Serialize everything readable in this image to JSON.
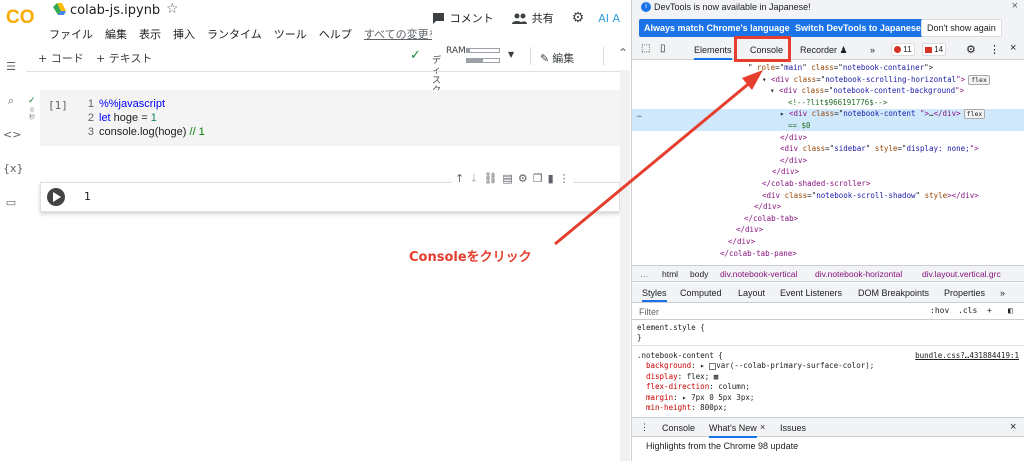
{
  "colab": {
    "logo_text": "CO",
    "file_name": "colab-js.ipynb",
    "menu": [
      "ファイル",
      "編集",
      "表示",
      "挿入",
      "ランタイム",
      "ツール",
      "ヘルプ"
    ],
    "last_edit": "すべての変更を",
    "comment_label": "コメント",
    "share_label": "共有",
    "ai_label": "AI A",
    "add_code": "+ コード",
    "add_text": "+ テキスト",
    "ram_label": "RAM",
    "disk_label": "ディスク",
    "ram_fraction": 0.1,
    "disk_fraction": 0.5,
    "edit_label": "編集",
    "cell1": {
      "number": "[1]",
      "exec_time": "0\n秒",
      "lines": [
        {
          "n": "1",
          "text": "%%javascript"
        },
        {
          "n": "2",
          "kw": "let",
          "rest": " hoge = ",
          "num": "1"
        },
        {
          "n": "3",
          "text": "console.log(hoge) ",
          "cmt": "// 1"
        }
      ]
    },
    "cell2_output": "1"
  },
  "devtools": {
    "notice": "DevTools is now available in Japanese!",
    "btn_match": "Always match Chrome's language",
    "btn_switch": "Switch DevTools to Japanese",
    "btn_dont": "Don't show again",
    "tabs": [
      "Elements",
      "Console",
      "Recorder ♟"
    ],
    "more": "»",
    "errors": "11",
    "warnings": "14",
    "dom_lines": [
      {
        "indent": 116,
        "parts": [
          [
            "txt",
            "\" "
          ],
          [
            "attr",
            "role"
          ],
          [
            "txt",
            "=\""
          ],
          [
            "val",
            "main"
          ],
          [
            "txt",
            "\" "
          ],
          [
            "attr",
            "class"
          ],
          [
            "txt",
            "=\""
          ],
          [
            "val",
            "notebook-container"
          ],
          [
            "txt",
            "\">"
          ]
        ]
      },
      {
        "indent": 130,
        "parts": [
          [
            "txt",
            "▾ "
          ],
          [
            "tag",
            "<div "
          ],
          [
            "attr",
            "class"
          ],
          [
            "txt",
            "=\""
          ],
          [
            "val",
            "notebook-scrolling-horizontal"
          ],
          [
            "tag",
            "\">"
          ]
        ],
        "badge": "flex"
      },
      {
        "indent": 138,
        "parts": [
          [
            "txt",
            "▾ "
          ],
          [
            "tag",
            "<div "
          ],
          [
            "attr",
            "class"
          ],
          [
            "txt",
            "=\""
          ],
          [
            "val",
            "notebook-content-background"
          ],
          [
            "tag",
            "\">"
          ]
        ]
      },
      {
        "indent": 156,
        "parts": [
          [
            "cm",
            "<!--?lit$966191776$-->"
          ]
        ]
      },
      {
        "indent": 148,
        "parts": [
          [
            "txt",
            "▸ "
          ],
          [
            "tag",
            "<div "
          ],
          [
            "attr",
            "class"
          ],
          [
            "txt",
            "=\""
          ],
          [
            "val",
            "notebook-content"
          ],
          [
            "tag",
            " \">"
          ],
          [
            "txt",
            "…"
          ],
          [
            "tag",
            "</div>"
          ]
        ],
        "badge": "flex"
      },
      {
        "indent": 156,
        "parts": [
          [
            "cm",
            "== $0"
          ]
        ]
      },
      {
        "indent": 148,
        "parts": [
          [
            "tag",
            "</div>"
          ]
        ]
      },
      {
        "indent": 148,
        "parts": [
          [
            "tag",
            "<div "
          ],
          [
            "attr",
            "class"
          ],
          [
            "txt",
            "=\""
          ],
          [
            "val",
            "sidebar"
          ],
          [
            "txt",
            "\" "
          ],
          [
            "attr",
            "style"
          ],
          [
            "txt",
            "=\""
          ],
          [
            "val",
            "display: none;"
          ],
          [
            "tag",
            "\">"
          ]
        ]
      },
      {
        "indent": 148,
        "parts": [
          [
            "tag",
            "</div>"
          ]
        ]
      },
      {
        "indent": 140,
        "parts": [
          [
            "tag",
            "</div>"
          ]
        ]
      },
      {
        "indent": 130,
        "parts": [
          [
            "tag",
            "</colab-shaded-scroller>"
          ]
        ]
      },
      {
        "indent": 130,
        "parts": [
          [
            "tag",
            "<div "
          ],
          [
            "attr",
            "class"
          ],
          [
            "txt",
            "=\""
          ],
          [
            "val",
            "notebook-scroll-shadow"
          ],
          [
            "txt",
            "\" "
          ],
          [
            "attr",
            "style"
          ],
          [
            "tag",
            ">"
          ],
          [
            "tag",
            "</div>"
          ]
        ]
      },
      {
        "indent": 122,
        "parts": [
          [
            "tag",
            "</div>"
          ]
        ]
      },
      {
        "indent": 112,
        "parts": [
          [
            "tag",
            "</colab-tab>"
          ]
        ]
      },
      {
        "indent": 104,
        "parts": [
          [
            "tag",
            "</div>"
          ]
        ]
      },
      {
        "indent": 96,
        "parts": [
          [
            "tag",
            "</div>"
          ]
        ]
      },
      {
        "indent": 88,
        "parts": [
          [
            "tag",
            "</colab-tab-pane>"
          ]
        ]
      }
    ],
    "crumbs": [
      "…",
      "html",
      "body",
      "div.notebook-vertical",
      "div.notebook-horizontal",
      "div.layout.vertical.grc"
    ],
    "subtabs": [
      "Styles",
      "Computed",
      "Layout",
      "Event Listeners",
      "DOM Breakpoints",
      "Properties"
    ],
    "filter_placeholder": "Filter",
    "filter_hov": ":hov",
    "filter_cls": ".cls",
    "styles": {
      "element_style": "element.style {",
      "close": "}",
      "selector": ".notebook-content {",
      "link": "bundle.css?…431884419:1",
      "props": [
        {
          "name": "background",
          "value": ": ▸ ",
          "swatch": true,
          "rest": "var(--colab-primary-surface-color);"
        },
        {
          "name": "display",
          "value": ": flex; ",
          "rest": "▦"
        },
        {
          "name": "flex-direction",
          "value": ": column;"
        },
        {
          "name": "margin",
          "value": ": ▸ 7px 0 5px 3px;"
        },
        {
          "name": "min-height",
          "value": ": 800px;"
        }
      ]
    },
    "drawer_tabs": [
      "Console",
      "What's New",
      "Issues"
    ],
    "highlights": "Highlights from the Chrome 98 update"
  },
  "annotation": {
    "label": "Consoleをクリック",
    "color": "#e53e2e"
  }
}
